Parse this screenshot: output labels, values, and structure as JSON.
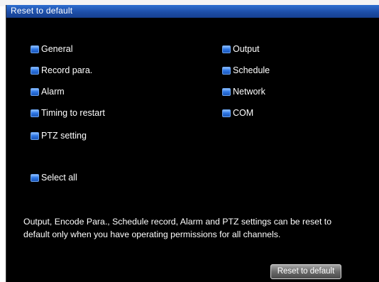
{
  "window": {
    "title": "Reset to default"
  },
  "options_left": [
    {
      "label": "General"
    },
    {
      "label": "Record para."
    },
    {
      "label": "Alarm"
    },
    {
      "label": "Timing to restart"
    },
    {
      "label": "PTZ setting"
    }
  ],
  "options_right": [
    {
      "label": "Output"
    },
    {
      "label": "Schedule"
    },
    {
      "label": "Network"
    },
    {
      "label": "COM"
    }
  ],
  "select_all": {
    "label": "Select all"
  },
  "note": {
    "line1": "Output, Encode Para., Schedule record, Alarm and PTZ settings can be reset to",
    "line2": "default only when you have operating permissions for all channels."
  },
  "reset_button": {
    "label": "Reset to default"
  },
  "colors": {
    "background": "#000000",
    "title_bar": "#1d4ea8",
    "checkbox": "#2f78e6",
    "text": "#ffffff"
  }
}
